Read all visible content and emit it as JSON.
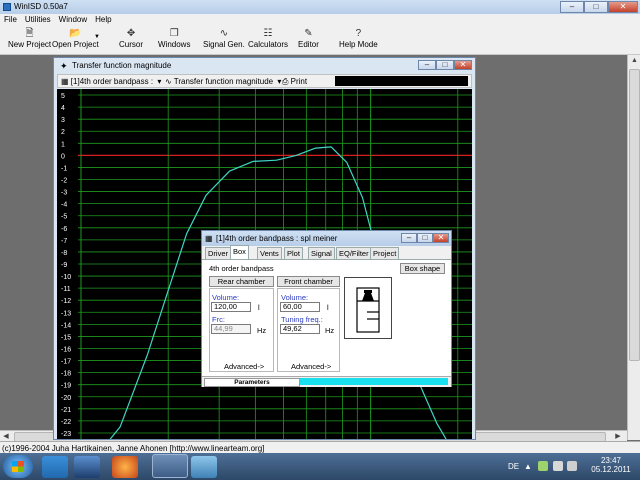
{
  "app": {
    "title": "WinISD 0.50a7"
  },
  "menu": [
    {
      "label": "File"
    },
    {
      "label": "Utilities"
    },
    {
      "label": "Window"
    },
    {
      "label": "Help"
    }
  ],
  "toolbar": {
    "new_project": "New Project",
    "open_project": "Open Project",
    "cursor": "Cursor",
    "windows": "Windows",
    "signal_gen": "Signal Gen.",
    "calculators": "Calculators",
    "editor": "Editor",
    "help_mode": "Help Mode"
  },
  "tf_window": {
    "title": "Transfer function magnitude",
    "project_select": "[1]4th order bandpass :",
    "graph_select": "Transfer function magnitude",
    "print": "Print",
    "y_ticks": [
      "5",
      "4",
      "3",
      "2",
      "1",
      "0",
      "-1",
      "-2",
      "-3",
      "-4",
      "-5",
      "-6",
      "-7",
      "-8",
      "-9",
      "-10",
      "-11",
      "-12",
      "-13",
      "-14",
      "-15",
      "-16",
      "-17",
      "-18",
      "-19",
      "-20",
      "-21",
      "-22",
      "-23"
    ],
    "colors": {
      "grid": "#1f9a1f",
      "zero": "#d61e1e",
      "curve": "#3fd6c6",
      "bg": "#000000"
    }
  },
  "chart_data": {
    "type": "line",
    "title": "",
    "xlabel": "",
    "ylabel": "",
    "ylim": [
      -23.5,
      5.5
    ],
    "x": [
      0,
      0.1,
      0.17,
      0.22,
      0.27,
      0.32,
      0.38,
      0.44,
      0.5,
      0.55,
      0.6,
      0.64,
      0.68,
      0.72,
      0.76,
      0.8,
      0.84,
      0.88,
      0.91,
      0.93,
      0.96,
      1.0
    ],
    "y": [
      -26.5,
      -22.5,
      -16.5,
      -11.5,
      -6.5,
      -3.3,
      -1.3,
      -0.5,
      -0.4,
      0,
      0.6,
      0.7,
      -0.6,
      -3.5,
      -8.5,
      -13,
      -17,
      -20,
      -22.2,
      -23.3,
      -25,
      -27
    ]
  },
  "dialog": {
    "title": "[1]4th order bandpass : spl meiner",
    "tabs": [
      "Driver",
      "Box",
      "Vents",
      "Plot",
      "Signal",
      "EQ/Filter",
      "Project"
    ],
    "active_tab": "Box",
    "box_type": "4th order bandpass",
    "box_shape_btn": "Box shape",
    "rear_chamber": "Rear chamber",
    "front_chamber": "Front chamber",
    "rear_volume_label": "Volume:",
    "rear_volume": "120,00",
    "rear_volume_unit": "l",
    "frc_label": "Frc:",
    "frc": "44,99",
    "frc_unit": "Hz",
    "front_volume_label": "Volume:",
    "front_volume": "60,00",
    "front_volume_unit": "l",
    "tuning_label": "Tuning freq.:",
    "tuning": "49,62",
    "tuning_unit": "Hz",
    "advanced_rear": "Advanced->",
    "advanced_front": "Advanced->",
    "footer": "Parameters"
  },
  "status": {
    "text": "(c)1996-2004 Juha Hartikainen, Janne Ahonen [http://www.linearteam.org]"
  },
  "taskbar": {
    "lang": "DE",
    "time": "23:47",
    "date": "05.12.2011"
  }
}
